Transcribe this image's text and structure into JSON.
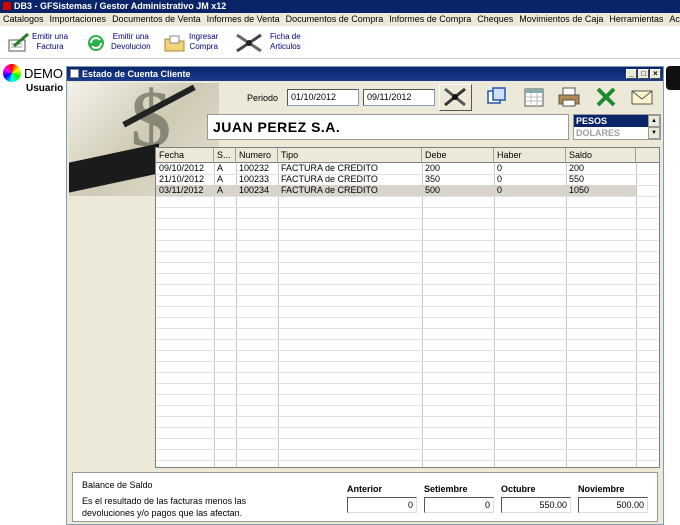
{
  "app_title": "DB3 - GFSistemas  / Gestor Administrativo JM x12",
  "menu": [
    "Catalogos",
    "Importaciones",
    "Documentos de Venta",
    "Informes de Venta",
    "Documentos de Compra",
    "Informes de Compra",
    "Cheques",
    "Movimientos de Caja",
    "Herramientas",
    "Acerca de este Producto"
  ],
  "toolbar": [
    {
      "line1": "Emitir una",
      "line2": "Factura",
      "icon": "invoice-pen-icon"
    },
    {
      "line1": "Emitir una",
      "line2": "Devolucion",
      "icon": "refresh-arrows-icon"
    },
    {
      "line1": "Ingresar",
      "line2": "Compra",
      "icon": "folder-compra-icon"
    },
    {
      "line1": "Ficha de",
      "line2": "Articulos",
      "icon": "tools-icon"
    }
  ],
  "background": {
    "demo": "DEMO",
    "usuario": "Usuario"
  },
  "window": {
    "title": "Estado de Cuenta Cliente",
    "periodo_label": "Periodo",
    "date_from": "01/10/2012",
    "date_to": "09/11/2012",
    "client_name": "JUAN PEREZ S.A.",
    "currencies": [
      "PESOS",
      "DOLARES"
    ],
    "selected_currency": "PESOS"
  },
  "grid": {
    "columns": [
      "Fecha",
      "S...",
      "Numero",
      "Tipo",
      "Debe",
      "Haber",
      "Saldo"
    ],
    "rows": [
      {
        "fecha": "09/10/2012",
        "serie": "A",
        "numero": "100232",
        "tipo": "FACTURA de CREDITO",
        "debe": "200",
        "haber": "0",
        "saldo": "200"
      },
      {
        "fecha": "21/10/2012",
        "serie": "A",
        "numero": "100233",
        "tipo": "FACTURA de CREDITO",
        "debe": "350",
        "haber": "0",
        "saldo": "550"
      },
      {
        "fecha": "03/11/2012",
        "serie": "A",
        "numero": "100234",
        "tipo": "FACTURA de CREDITO",
        "debe": "500",
        "haber": "0",
        "saldo": "1050"
      }
    ],
    "selected_row": 2
  },
  "balance": {
    "title": "Balance de Saldo",
    "description": "Es el resultado de las facturas menos las devoluciones y/o pagos que las afectan.",
    "months": [
      {
        "label": "Anterior",
        "value": "0"
      },
      {
        "label": "Setiembre",
        "value": "0"
      },
      {
        "label": "Octubre",
        "value": "550.00"
      },
      {
        "label": "Noviembre",
        "value": "500.00"
      }
    ]
  },
  "colors": {
    "titlebar": "#0a246a",
    "window_bg": "#ece9d8",
    "selection": "#d8d4cc",
    "currency_selected": "#0a246a"
  }
}
